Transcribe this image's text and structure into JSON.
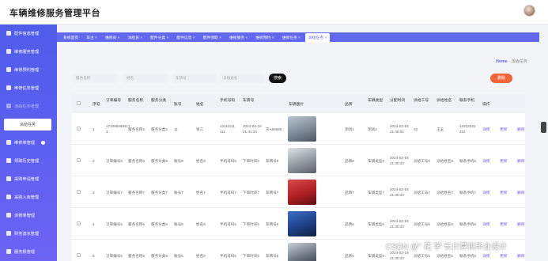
{
  "app": {
    "title": "车辆维修服务管理平台"
  },
  "sidebar": {
    "items": [
      {
        "label": "配件信息管理"
      },
      {
        "label": "维修服务管理"
      },
      {
        "label": "维修预约管理"
      },
      {
        "label": "维修任务管理"
      },
      {
        "label": "派给任务管理"
      },
      {
        "label": "维修单管理"
      },
      {
        "label": "领取历史管理"
      },
      {
        "label": "采购申请管理"
      },
      {
        "label": "采购入库管理"
      },
      {
        "label": "派修单管理"
      },
      {
        "label": "财务流水管理"
      },
      {
        "label": "服务报管理"
      }
    ],
    "submenu_label": "派给任务"
  },
  "tabs": [
    {
      "label": "系统首页"
    },
    {
      "label": "车主 ×"
    },
    {
      "label": "维修员 ×"
    },
    {
      "label": "派给员 ×"
    },
    {
      "label": "配件分类 ×"
    },
    {
      "label": "配件信息 ×"
    },
    {
      "label": "配件领取 ×"
    },
    {
      "label": "维修服务 ×"
    },
    {
      "label": "维修预约 ×"
    },
    {
      "label": "维修任务 ×"
    },
    {
      "label": "派给任务 ×"
    }
  ],
  "breadcrumb": {
    "home": "Home",
    "sep": "-",
    "current": "派给任务"
  },
  "search": {
    "placeholder_1": "服务名称",
    "placeholder_2": "姓名",
    "placeholder_3": "车牌号",
    "placeholder_4": "派给姓名",
    "button": "搜索",
    "delete_button": "删除"
  },
  "table": {
    "headers": [
      "序号",
      "订单编号",
      "服务名称",
      "服务分类",
      "账号",
      "姓名",
      "手机号码",
      "车牌号",
      "车辆图片",
      "品牌",
      "车辆类型",
      "分配时间",
      "派给工号",
      "派给姓名",
      "联系手机",
      "操作"
    ],
    "rows": [
      {
        "idx": "1",
        "order": "1710855694173",
        "service": "服务名称2",
        "category": "服务分类2",
        "account": "11",
        "name": "张三",
        "phone": "13111111111",
        "time": "2024-03-19 21:41:34",
        "plate": "京A66666",
        "brand": "测试1",
        "type": "测试2",
        "assign": "2024-03-19 21:45:01",
        "worker_id": "33",
        "worker": "王五",
        "contact": "13232322222"
      },
      {
        "idx": "2",
        "order": "订单编号8",
        "service": "服务名称8",
        "category": "服务分类8",
        "account": "账号8",
        "name": "姓名8",
        "phone": "手机号码8",
        "time": "下单时间8",
        "plate": "车牌号8",
        "brand": "品牌8",
        "type": "车辆类型8",
        "assign": "2024-03-19 21:30:33",
        "worker_id": "派给工号8",
        "worker": "派给姓名8",
        "contact": "联系手机8"
      },
      {
        "idx": "3",
        "order": "订单编号7",
        "service": "服务名称7",
        "category": "服务分类7",
        "account": "账号7",
        "name": "姓名7",
        "phone": "手机号码7",
        "time": "下单时间7",
        "plate": "车牌号7",
        "brand": "品牌7",
        "type": "车辆类型7",
        "assign": "2024-03-19 21:30:33",
        "worker_id": "派给工号7",
        "worker": "派给姓名7",
        "contact": "联系手机7"
      },
      {
        "idx": "4",
        "order": "订单编号6",
        "service": "服务名称6",
        "category": "服务分类6",
        "account": "账号6",
        "name": "姓名6",
        "phone": "手机号码6",
        "time": "下单时间6",
        "plate": "车牌号6",
        "brand": "品牌6",
        "type": "车辆类型6",
        "assign": "2024-03-19 21:30:33",
        "worker_id": "派给工号6",
        "worker": "派给姓名6",
        "contact": "联系手机6"
      },
      {
        "idx": "5",
        "order": "订单编号5",
        "service": "服务名称5",
        "category": "服务分类5",
        "account": "账号5",
        "name": "姓名5",
        "phone": "手机号码5",
        "time": "下单时间5",
        "plate": "车牌号5",
        "brand": "品牌5",
        "type": "车辆类型5",
        "assign": "2024-03-19 21:30:33",
        "worker_id": "派给工号5",
        "worker": "派给姓名5",
        "contact": "联系手机5"
      }
    ],
    "actions": [
      "详情",
      "更新",
      "删除"
    ]
  },
  "watermark": "CSDN @\" 花 学 长计算机毕业设计",
  "colors": {
    "sidebar": "#5a5ff0",
    "accent": "#5c63ee",
    "danger": "#f2653b",
    "action": "#7a5cf5"
  }
}
